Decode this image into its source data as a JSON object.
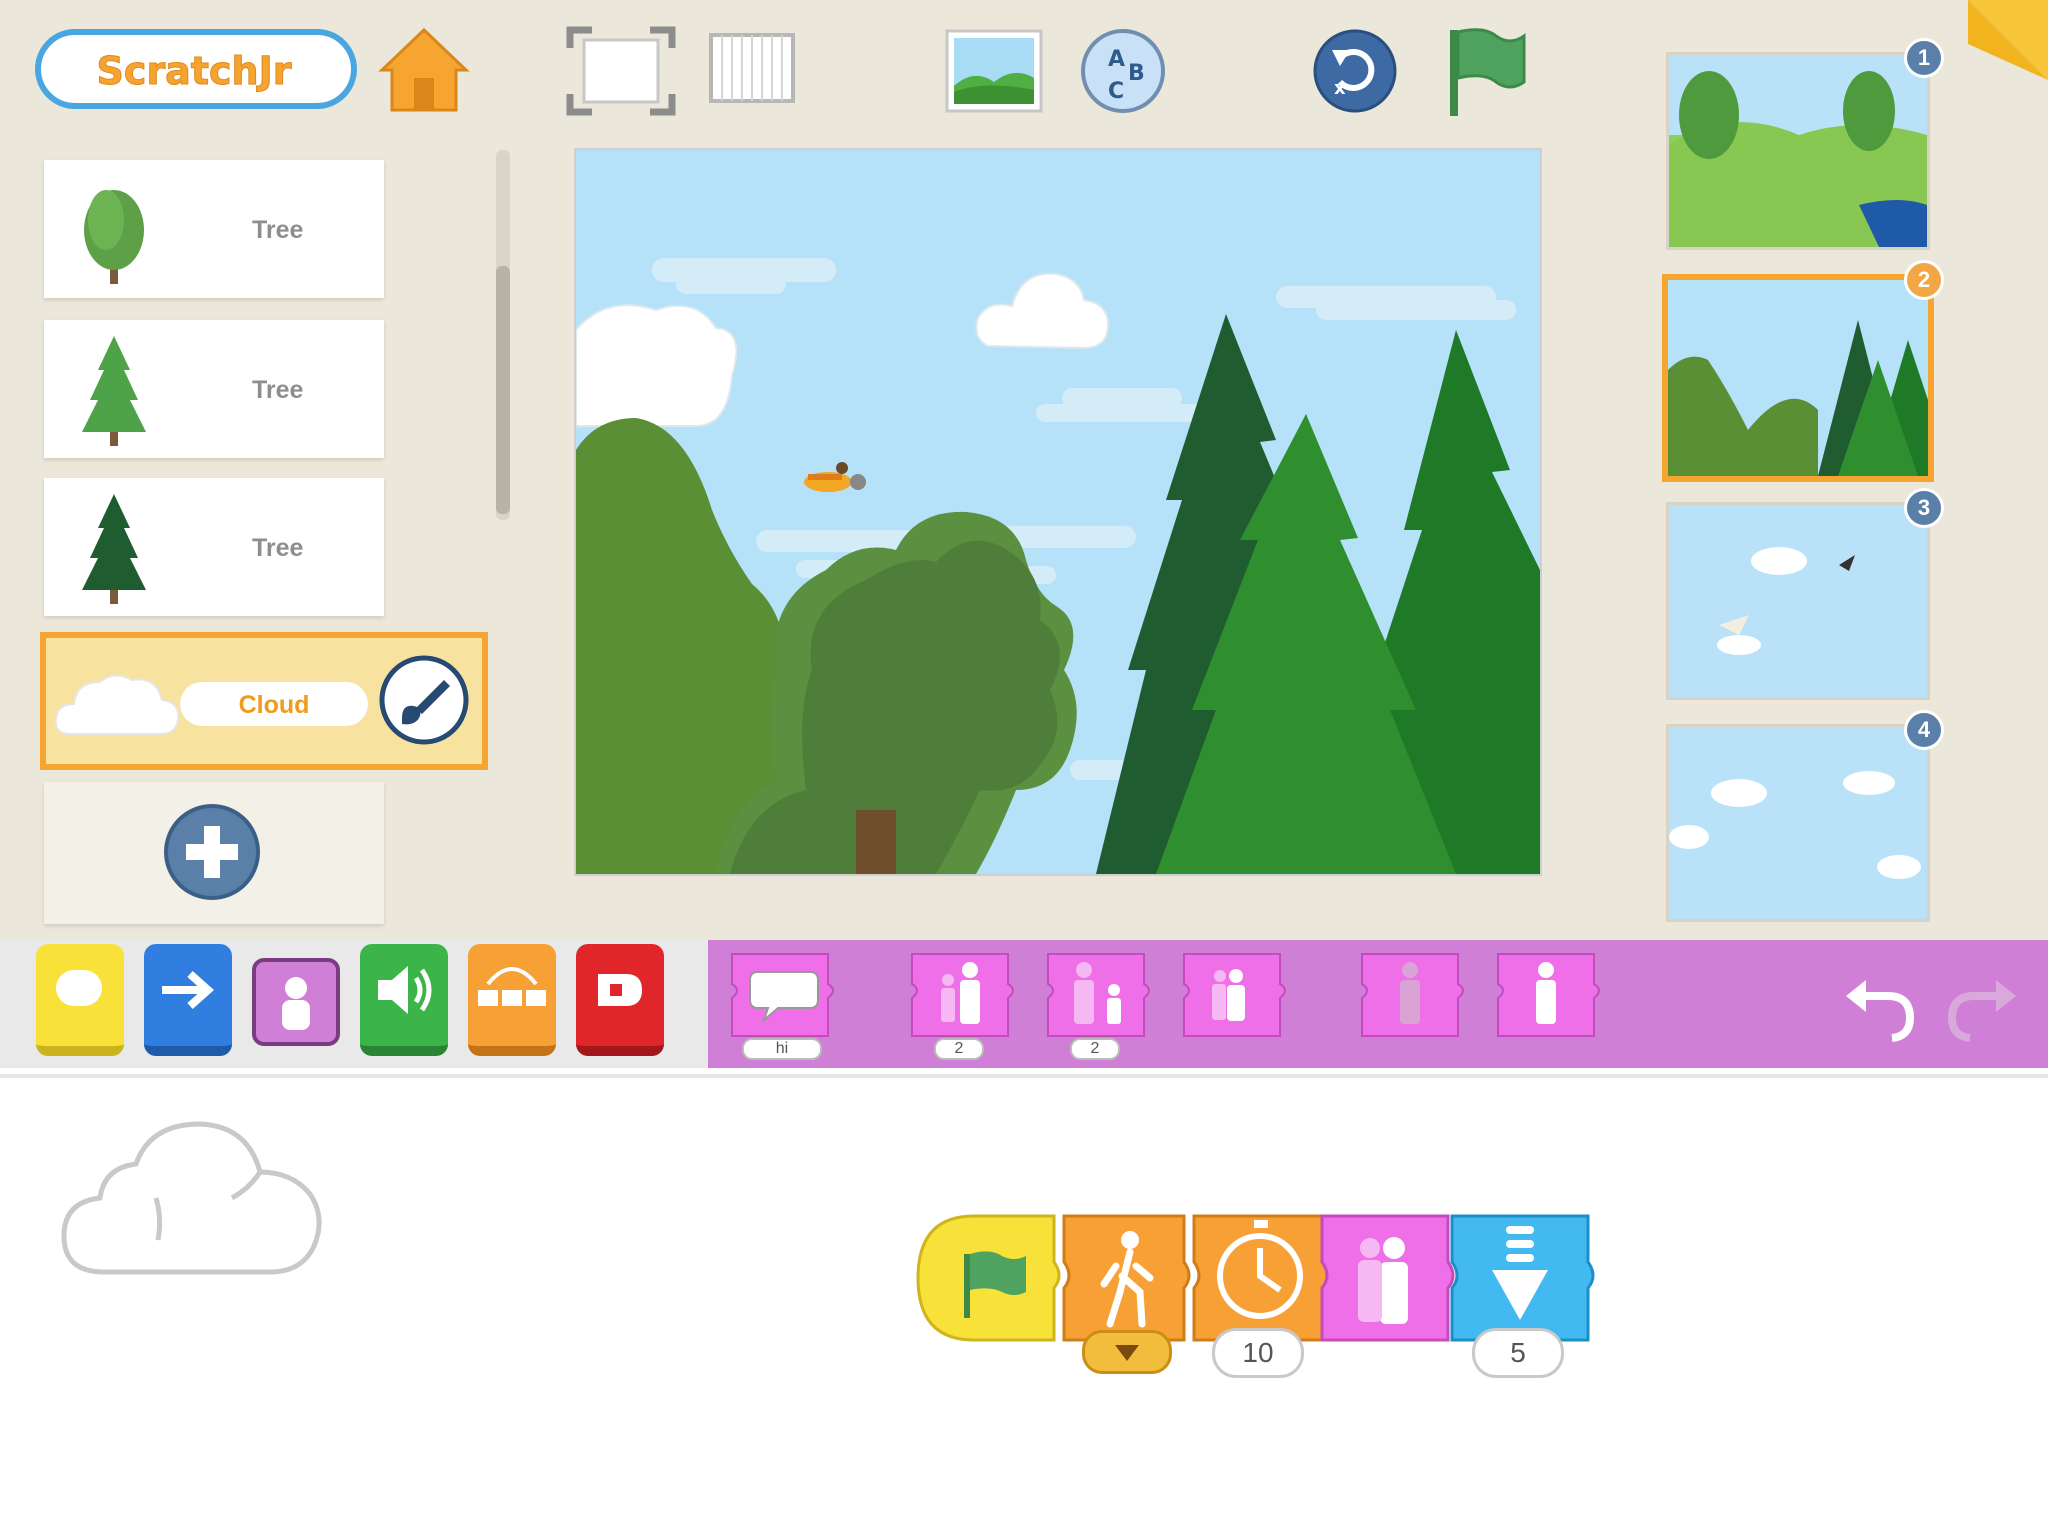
{
  "app": {
    "logo_text": "ScratchJr"
  },
  "colors": {
    "accent_orange": "#f6a531",
    "looks_purple": "#cf7fd6",
    "trigger_yellow": "#f8e23a",
    "motion_blue": "#2f7ee0",
    "sound_green": "#3bb54a",
    "control_orange": "#f7a036",
    "end_red": "#e0262b"
  },
  "sprites": [
    {
      "label": "Tree",
      "icon": "deciduous-tree-icon"
    },
    {
      "label": "Tree",
      "icon": "pine-tree-icon"
    },
    {
      "label": "Tree",
      "icon": "dark-pine-tree-icon"
    },
    {
      "label": "Cloud",
      "icon": "cloud-icon",
      "selected": true
    }
  ],
  "scenes": [
    {
      "number": "1"
    },
    {
      "number": "2",
      "selected": true
    },
    {
      "number": "3"
    },
    {
      "number": "4"
    }
  ],
  "palette": {
    "categories": [
      "triggering",
      "motion",
      "looks",
      "sound",
      "control",
      "end"
    ],
    "selected_category": "looks",
    "blocks": [
      {
        "icon": "say-icon",
        "value": "hi"
      },
      {
        "icon": "grow-icon",
        "value": "2"
      },
      {
        "icon": "shrink-icon",
        "value": "2"
      },
      {
        "icon": "reset-size-icon"
      },
      {
        "icon": "hide-icon"
      },
      {
        "icon": "show-icon"
      }
    ]
  },
  "script": {
    "blocks": [
      {
        "icon": "green-flag-icon"
      },
      {
        "icon": "send-message-icon",
        "dropdown": true
      },
      {
        "icon": "wait-icon",
        "value": "10"
      },
      {
        "icon": "reset-size-icon"
      },
      {
        "icon": "move-down-icon",
        "value": "5"
      }
    ]
  }
}
